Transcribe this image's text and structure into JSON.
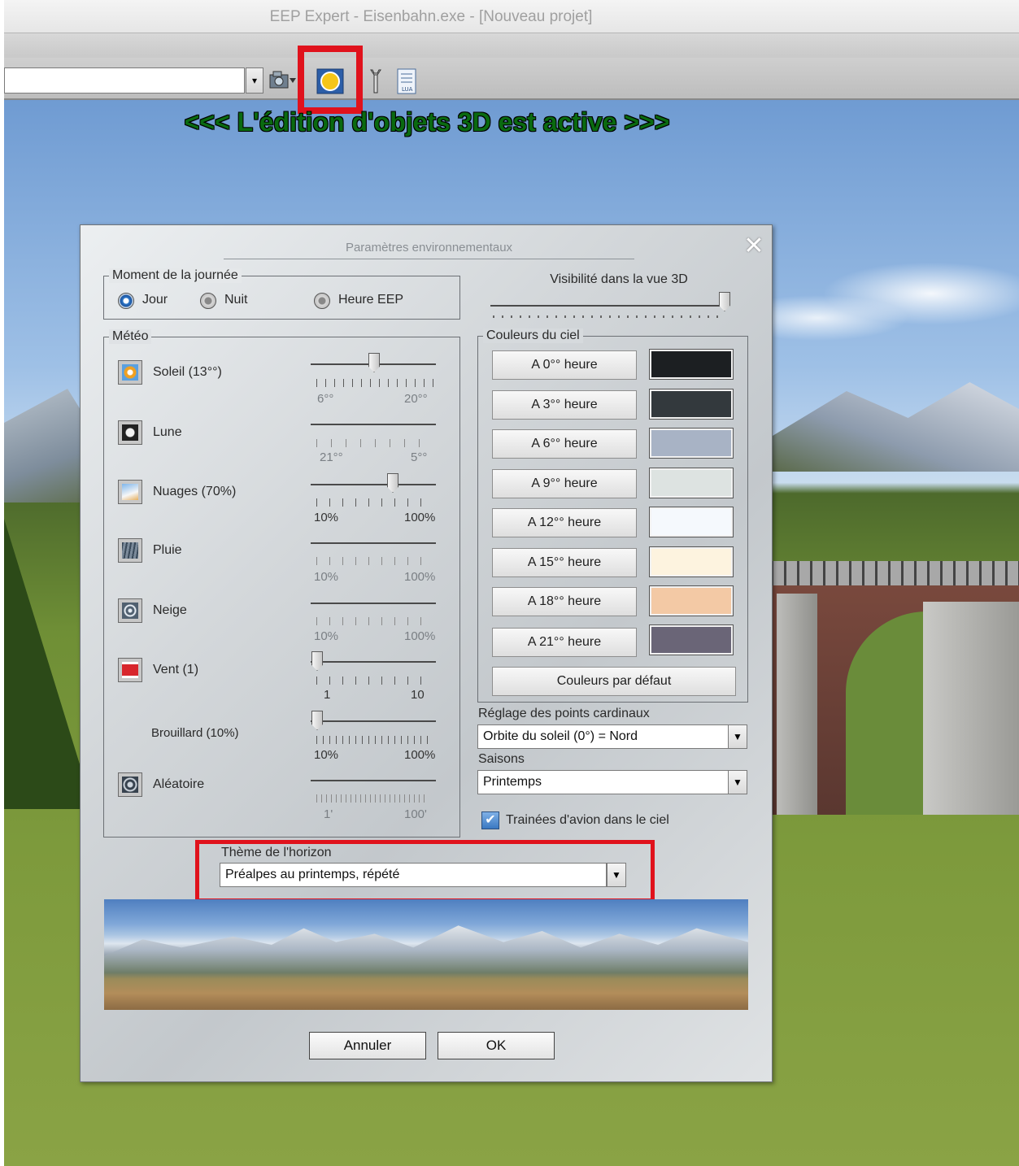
{
  "window": {
    "title": "EEP Expert - Eisenbahn.exe - [Nouveau projet]"
  },
  "toolbar": {
    "combo_value": "",
    "icons": [
      "camera-dropdown-icon",
      "environment-sun-icon",
      "tools-wrench-icon",
      "lua-script-icon"
    ]
  },
  "banner": {
    "text": "<<<  L'édition d'objets 3D est active  >>>",
    "color": "#0a6a10"
  },
  "highlight_color": "#e0121c",
  "dialog": {
    "title": "Paramètres environnementaux",
    "time_of_day": {
      "label": "Moment de la journée",
      "options": [
        "Jour",
        "Nuit",
        "Heure EEP"
      ],
      "selected": "Jour"
    },
    "visibility": {
      "label": "Visibilité dans la vue 3D",
      "value_fraction": 1.0
    },
    "weather": {
      "label": "Météo",
      "items": [
        {
          "name": "Soleil (13°°)",
          "icon": "sun-icon",
          "min": "6°°",
          "max": "20°°",
          "value_fraction": 0.5,
          "enabled": true
        },
        {
          "name": "Lune",
          "icon": "moon-icon",
          "min": "21°°",
          "max": "5°°",
          "value_fraction": null,
          "enabled": false
        },
        {
          "name": "Nuages (70%)",
          "icon": "clouds-icon",
          "min": "10%",
          "max": "100%",
          "value_fraction": 0.67,
          "enabled": true
        },
        {
          "name": "Pluie",
          "icon": "rain-icon",
          "min": "10%",
          "max": "100%",
          "value_fraction": null,
          "enabled": false
        },
        {
          "name": "Neige",
          "icon": "snow-icon",
          "min": "10%",
          "max": "100%",
          "value_fraction": null,
          "enabled": false
        },
        {
          "name": "Vent (1)",
          "icon": "wind-icon",
          "min": "1",
          "max": "10",
          "value_fraction": 0.0,
          "enabled": true
        },
        {
          "name": "Brouillard (10%)",
          "icon": "",
          "min": "10%",
          "max": "100%",
          "value_fraction": 0.0,
          "enabled": true
        },
        {
          "name": "Aléatoire",
          "icon": "random-icon",
          "min": "1'",
          "max": "100'",
          "value_fraction": null,
          "enabled": false
        }
      ]
    },
    "sky_colors": {
      "label": "Couleurs du ciel",
      "rows": [
        {
          "label": "A 0°° heure",
          "color": "#1c1f22"
        },
        {
          "label": "A 3°° heure",
          "color": "#33393d"
        },
        {
          "label": "A 6°° heure",
          "color": "#a8b3c5"
        },
        {
          "label": "A 9°° heure",
          "color": "#dde3e1"
        },
        {
          "label": "A 12°° heure",
          "color": "#f5f9fd"
        },
        {
          "label": "A 15°° heure",
          "color": "#fdf3df"
        },
        {
          "label": "A 18°° heure",
          "color": "#f3c9a5"
        },
        {
          "label": "A 21°° heure",
          "color": "#6a6577"
        }
      ],
      "default_button": "Couleurs par défaut"
    },
    "cardinal": {
      "label": "Réglage des points cardinaux",
      "value": "Orbite du soleil (0°) = Nord"
    },
    "seasons": {
      "label": "Saisons",
      "value": "Printemps"
    },
    "contrails": {
      "label": "Trainées d'avion dans le ciel",
      "checked": true
    },
    "horizon": {
      "label": "Thème de l'horizon",
      "value": "Préalpes au printemps, répété"
    },
    "buttons": {
      "cancel": "Annuler",
      "ok": "OK"
    }
  }
}
